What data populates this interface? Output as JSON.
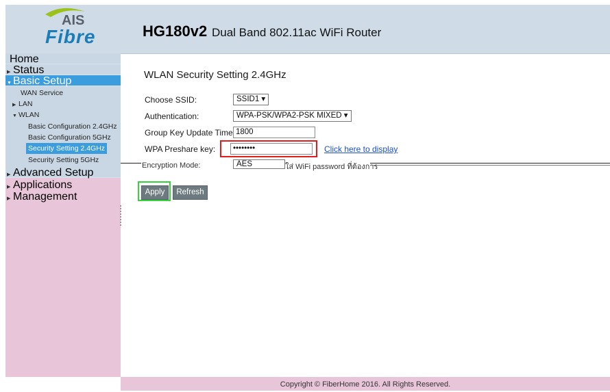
{
  "header": {
    "logo_top": "AIS",
    "logo_bottom": "Fibre",
    "model": "HG180v2",
    "model_desc": "Dual Band 802.11ac WiFi Router"
  },
  "sidebar": {
    "home": "Home",
    "status": "Status",
    "basic_setup": "Basic Setup",
    "wan_service": "WAN Service",
    "lan": "LAN",
    "wlan": "WLAN",
    "basic_conf_24": "Basic Configuration 2.4GHz",
    "basic_conf_5": "Basic Configuration 5GHz",
    "security_24": "Security Setting 2.4GHz",
    "security_5": "Security Setting 5GHz",
    "advanced_setup": "Advanced Setup",
    "applications": "Applications",
    "management": "Management"
  },
  "main": {
    "title": "WLAN Security Setting 2.4GHz",
    "choose_ssid_label": "Choose SSID:",
    "choose_ssid_value": "SSID1 ▾",
    "auth_label": "Authentication:",
    "auth_value": "WPA-PSK/WPA2-PSK MIXED ▾",
    "group_key_label": "Group Key Update Timer:",
    "group_key_value": "1800",
    "preshare_label": "WPA Preshare key:",
    "preshare_value": "••••••••",
    "display_link": "Click here to display",
    "encryption_label": "Encryption Mode:",
    "encryption_value": "AES",
    "encryption_note": "ใส่ WiFi password ที่ต้องการ",
    "apply_button": "Apply",
    "refresh_button": "Refresh"
  },
  "footer": {
    "copyright": "Copyright © FiberHome 2016. All Rights Reserved."
  },
  "colors": {
    "header_bg": "#cfdce8",
    "sidebar_bg": "#e8c5d8",
    "active_blue": "#3b9ddd",
    "highlight_red": "#e21b1b",
    "highlight_green": "#35d23a",
    "button_gray": "#6d7a7f"
  }
}
